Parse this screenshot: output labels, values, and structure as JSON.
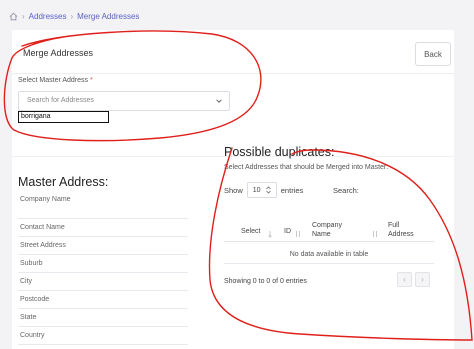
{
  "breadcrumb": {
    "items": [
      "Addresses",
      "Merge Addresses"
    ]
  },
  "card": {
    "title": "Merge Addresses",
    "back_label": "Back"
  },
  "master_select": {
    "label": "Select Master Address",
    "required_mark": "*",
    "placeholder": "Search for Addresses",
    "typed_value": "borrigana"
  },
  "master_address": {
    "heading": "Master Address:",
    "fields": [
      "Company Name",
      "Contact Name",
      "Street Address",
      "Suburb",
      "City",
      "Postcode",
      "State",
      "Country"
    ]
  },
  "duplicates": {
    "heading": "Possible duplicates:",
    "subtitle": "Select Addresses that should be Merged into Master:",
    "show_label": "Show",
    "entries_value": "10",
    "entries_label": "entries",
    "search_label": "Search:",
    "columns": [
      "Select",
      "ID",
      "Company Name",
      "Full Address"
    ],
    "empty_text": "No data available in table",
    "info_text": "Showing 0 to 0 of 0 entries"
  },
  "pager": {
    "prev": "‹",
    "next": "›"
  },
  "colors": {
    "accent": "#5b5fc7",
    "annotation": "#e0201b"
  }
}
